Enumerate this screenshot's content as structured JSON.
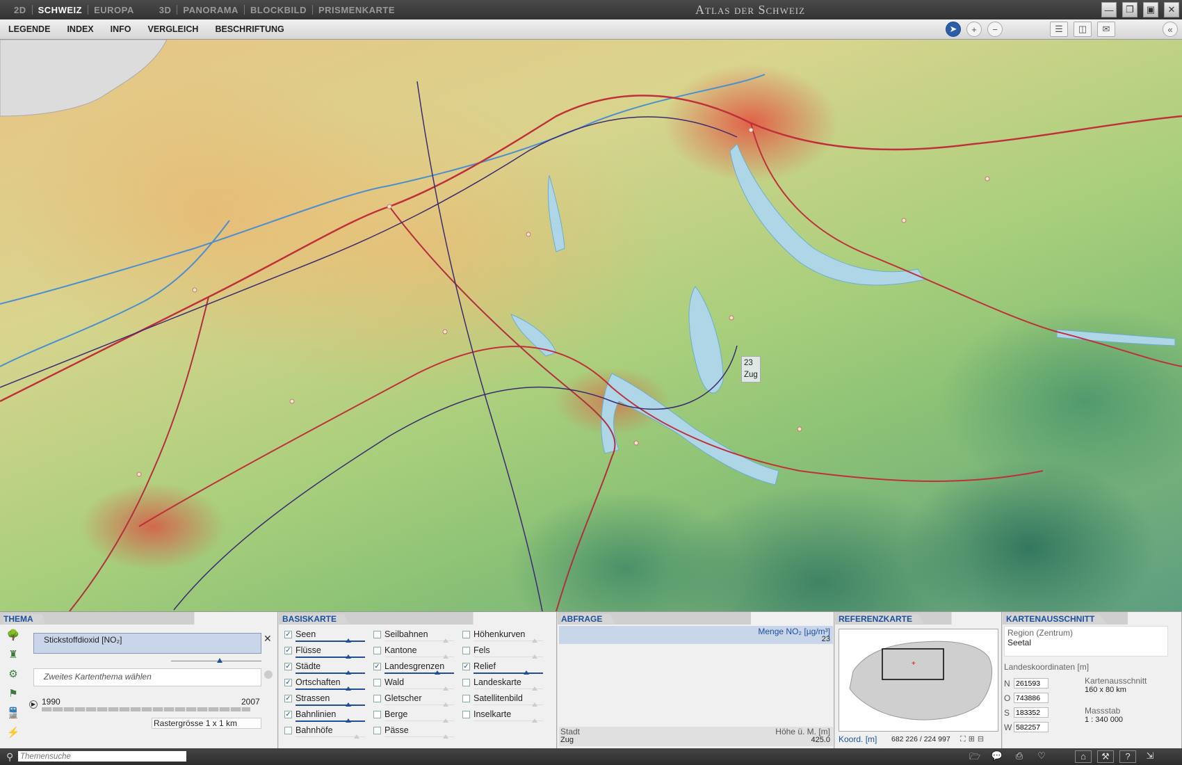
{
  "titlebar": {
    "tabs_2d": [
      "2D",
      "SCHWEIZ",
      "EUROPA"
    ],
    "tabs_3d": [
      "3D",
      "PANORAMA",
      "BLOCKBILD",
      "PRISMENKARTE"
    ],
    "app_title": "Atlas der Schweiz"
  },
  "menu": [
    "LEGENDE",
    "INDEX",
    "INFO",
    "VERGLEICH",
    "BESCHRIFTUNG"
  ],
  "map": {
    "tooltip_value": "23",
    "tooltip_name": "Zug"
  },
  "thema": {
    "title": "THEMA",
    "current_theme": "Stickstoffdioxid [NO₂]",
    "second_placeholder": "Zweites Kartenthema wählen",
    "year_from": "1990",
    "year_to": "2007",
    "raster": "Rastergrösse 1 x 1 km"
  },
  "basiskarte": {
    "title": "BASISKARTE",
    "col1": [
      {
        "label": "Seen",
        "checked": true
      },
      {
        "label": "Flüsse",
        "checked": true
      },
      {
        "label": "Städte",
        "checked": true
      },
      {
        "label": "Ortschaften",
        "checked": true
      },
      {
        "label": "Strassen",
        "checked": true
      },
      {
        "label": "Bahnlinien",
        "checked": true
      },
      {
        "label": "Bahnhöfe",
        "checked": false
      }
    ],
    "col2": [
      {
        "label": "Seilbahnen",
        "checked": false
      },
      {
        "label": "Kantone",
        "checked": false
      },
      {
        "label": "Landesgrenzen",
        "checked": true
      },
      {
        "label": "Wald",
        "checked": false
      },
      {
        "label": "Gletscher",
        "checked": false
      },
      {
        "label": "Berge",
        "checked": false
      },
      {
        "label": "Pässe",
        "checked": false
      }
    ],
    "col3": [
      {
        "label": "Höhenkurven",
        "checked": false
      },
      {
        "label": "Fels",
        "checked": false
      },
      {
        "label": "Relief",
        "checked": true
      },
      {
        "label": "Landeskarte",
        "checked": false
      },
      {
        "label": "Satellitenbild",
        "checked": false
      },
      {
        "label": "Inselkarte",
        "checked": false
      }
    ]
  },
  "abfrage": {
    "title": "ABFRAGE",
    "measure_label": "Menge NO₂ [µg/m³]",
    "measure_value": "23",
    "stadt_label": "Stadt",
    "stadt_value": "Zug",
    "hoehe_label": "Höhe ü. M. [m]",
    "hoehe_value": "425.0"
  },
  "referenzkarte": {
    "title": "REFERENZKARTE",
    "koord_label": "Koord. [m]",
    "koord_value": "682 226 / 224 997"
  },
  "kartenausschnitt": {
    "title": "KARTENAUSSCHNITT",
    "region_label": "Region (Zentrum)",
    "region_value": "Seetal",
    "landeskoord_label": "Landeskoordinaten [m]",
    "coords": [
      {
        "dir": "N",
        "value": "261593"
      },
      {
        "dir": "O",
        "value": "743886"
      },
      {
        "dir": "S",
        "value": "183352"
      },
      {
        "dir": "W",
        "value": "582257"
      }
    ],
    "ausschnitt_label": "Kartenausschnitt",
    "ausschnitt_value": "160 x 80 km",
    "massstab_label": "Massstab",
    "massstab_value": "1 : 340 000"
  },
  "statusbar": {
    "search_placeholder": "Themensuche"
  }
}
